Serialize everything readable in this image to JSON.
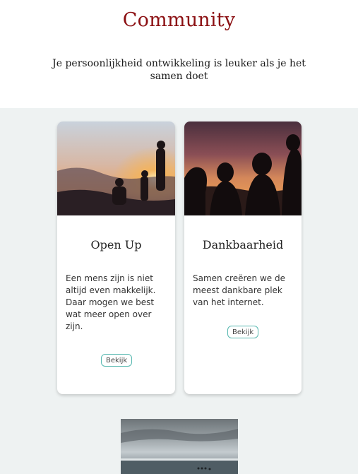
{
  "header": {
    "title": "Community",
    "subtitle": "Je persoonlijkheid ontwikkeling is leuker als je het samen doet"
  },
  "cards": [
    {
      "title": "Open Up",
      "text": "Een mens zijn is niet altijd even makkelijk. Daar mogen we best wat meer open over zijn.",
      "button_label": "Bekijk",
      "image_icon": "sunset-friends-photo"
    },
    {
      "title": "Dankbaarheid",
      "text": "Samen creëren we de meest dankbare plek van het internet.",
      "button_label": "Bekijk",
      "image_icon": "silhouette-group-photo"
    }
  ],
  "third_card": {
    "image_icon": "sea-horizon-photo"
  },
  "colors": {
    "title": "#8b0f12",
    "section_bg": "#eef2f2",
    "button_border": "#57b8b0"
  }
}
